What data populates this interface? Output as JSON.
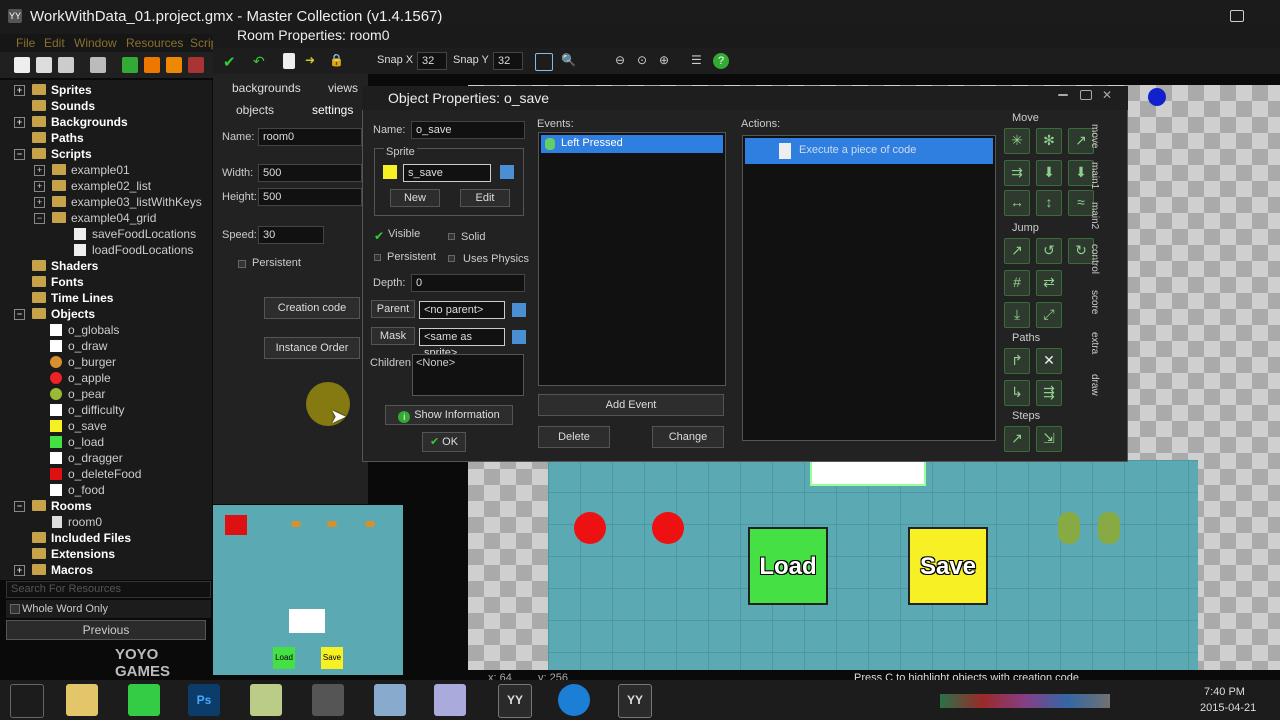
{
  "window": {
    "title": "WorkWithData_01.project.gmx - Master Collection (v1.4.1567)"
  },
  "menu": [
    "File",
    "Edit",
    "Window",
    "Resources",
    "Scripts"
  ],
  "tree": {
    "folders": [
      {
        "label": "Sprites"
      },
      {
        "label": "Sounds"
      },
      {
        "label": "Backgrounds"
      },
      {
        "label": "Paths"
      },
      {
        "label": "Scripts"
      },
      {
        "label": "Shaders"
      },
      {
        "label": "Fonts"
      },
      {
        "label": "Time Lines"
      },
      {
        "label": "Objects"
      },
      {
        "label": "Rooms"
      },
      {
        "label": "Included Files"
      },
      {
        "label": "Extensions"
      },
      {
        "label": "Macros"
      }
    ],
    "scripts": [
      "example01",
      "example02_list",
      "example03_listWithKeys",
      "example04_grid"
    ],
    "grid_scripts": [
      "saveFoodLocations",
      "loadFoodLocations"
    ],
    "objects": [
      "o_globals",
      "o_draw",
      "o_burger",
      "o_apple",
      "o_pear",
      "o_difficulty",
      "o_save",
      "o_load",
      "o_dragger",
      "o_deleteFood",
      "o_food"
    ],
    "rooms": [
      "room0"
    ],
    "search_placeholder": "Search For Resources",
    "whole_word": "Whole Word Only",
    "previous": "Previous"
  },
  "logo": "YOYO GAMES",
  "room": {
    "title": "Room Properties: room0",
    "snapx_label": "Snap X",
    "snapx": "32",
    "snapy_label": "Snap Y",
    "snapy": "32",
    "tabs": [
      "backgrounds",
      "views",
      "objects",
      "settings"
    ],
    "name_label": "Name:",
    "name": "room0",
    "width_label": "Width:",
    "width": "500",
    "height_label": "Height:",
    "height": "500",
    "speed_label": "Speed:",
    "speed": "30",
    "persistent_label": "Persistent",
    "creation_code": "Creation code",
    "instance_order": "Instance Order",
    "status_hint": "Press C to highlight objects with creation code",
    "coord_x": "x: 64",
    "coord_y": "y: 256"
  },
  "objprops": {
    "title": "Object Properties: o_save",
    "name_label": "Name:",
    "name": "o_save",
    "sprite_label": "Sprite",
    "sprite": "s_save",
    "new": "New",
    "edit": "Edit",
    "visible": "Visible",
    "solid": "Solid",
    "persistent": "Persistent",
    "uses_physics": "Uses Physics",
    "depth_label": "Depth:",
    "depth": "0",
    "parent_btn": "Parent",
    "parent": "<no parent>",
    "mask_btn": "Mask",
    "mask": "<same as sprite>",
    "children_label": "Children:",
    "children": "<None>",
    "show_info": "Show Information",
    "ok": "OK",
    "events_label": "Events:",
    "events": [
      "Left Pressed"
    ],
    "actions_label": "Actions:",
    "actions": [
      "Execute a piece of code"
    ],
    "add_event": "Add Event",
    "delete": "Delete",
    "change": "Change",
    "sections": [
      "Move",
      "Jump",
      "Paths",
      "Steps"
    ],
    "side_tabs": [
      "move",
      "main1",
      "main2",
      "control",
      "score",
      "extra",
      "draw"
    ]
  },
  "room_objects": {
    "load": "Load",
    "save": "Save"
  },
  "clock": {
    "time": "7:40 PM",
    "date": "2015-04-21"
  },
  "colors": {
    "teal": "#5aa9b3",
    "load_green": "#44e044",
    "save_yellow": "#f6f024",
    "select_blue": "#2f7fe0"
  }
}
